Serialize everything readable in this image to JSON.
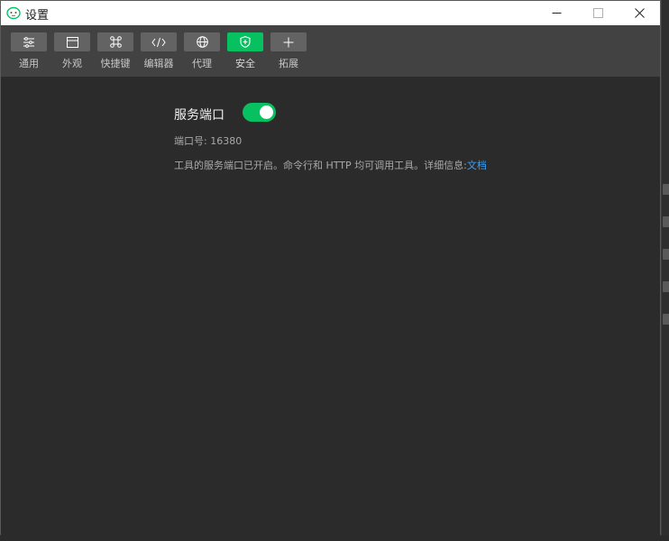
{
  "window": {
    "title": "设置"
  },
  "toolbar": {
    "items": [
      {
        "label": "通用",
        "icon": "sliders-icon",
        "active": false
      },
      {
        "label": "外观",
        "icon": "window-icon",
        "active": false
      },
      {
        "label": "快捷键",
        "icon": "command-icon",
        "active": false
      },
      {
        "label": "编辑器",
        "icon": "code-icon",
        "active": false
      },
      {
        "label": "代理",
        "icon": "globe-icon",
        "active": false
      },
      {
        "label": "安全",
        "icon": "shield-icon",
        "active": true
      },
      {
        "label": "拓展",
        "icon": "plus-icon",
        "active": false
      }
    ]
  },
  "service_port": {
    "title": "服务端口",
    "enabled": true,
    "port_label": "端口号:",
    "port_value": "16380",
    "description": "工具的服务端口已开启。命令行和 HTTP 均可调用工具。详细信息:",
    "doc_link": "文档"
  },
  "colors": {
    "accent": "#07c160",
    "link": "#3a9ff5",
    "background": "#2b2b2b",
    "toolbar": "#424242"
  }
}
